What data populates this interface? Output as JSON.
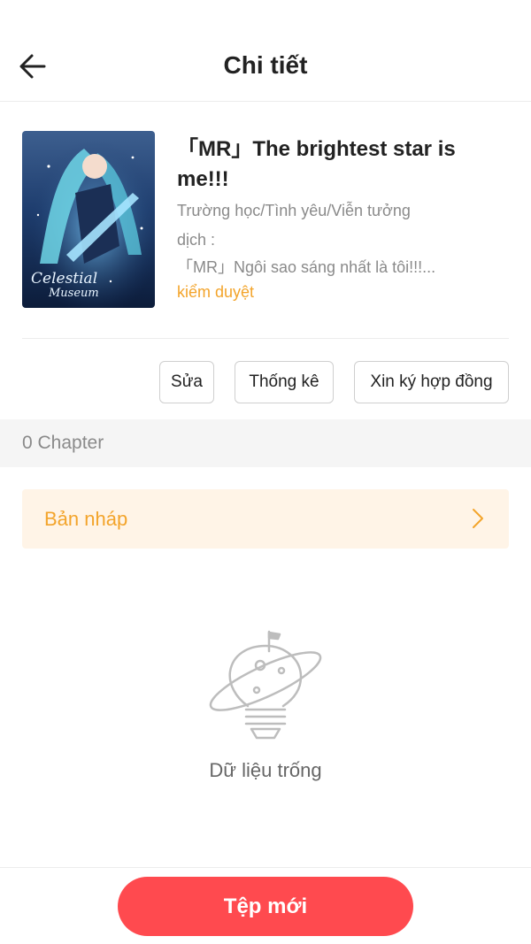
{
  "header": {
    "title": "Chi tiết",
    "back_icon": "arrow-left-icon"
  },
  "book": {
    "title": "「MR」The brightest star is me!!!",
    "genres": "Trường học/Tình yêu/Viễn tưởng",
    "translation_label": "dịch :",
    "translated_title": "「MR」Ngôi sao sáng nhất là tôi!!!...",
    "status": "kiểm duyệt",
    "status_color": "#f3a42b"
  },
  "actions": {
    "edit_label": "Sửa",
    "stats_label": "Thống kê",
    "contract_label": "Xin ký hợp đồng"
  },
  "chapters": {
    "count_label": "0 Chapter"
  },
  "draft": {
    "label": "Bản nháp",
    "chevron_icon": "chevron-right-icon"
  },
  "empty_state": {
    "icon": "planet-lightbulb-icon",
    "text": "Dữ liệu trống"
  },
  "footer": {
    "new_file_label": "Tệp mới",
    "accent_color": "#ff4a4f"
  }
}
